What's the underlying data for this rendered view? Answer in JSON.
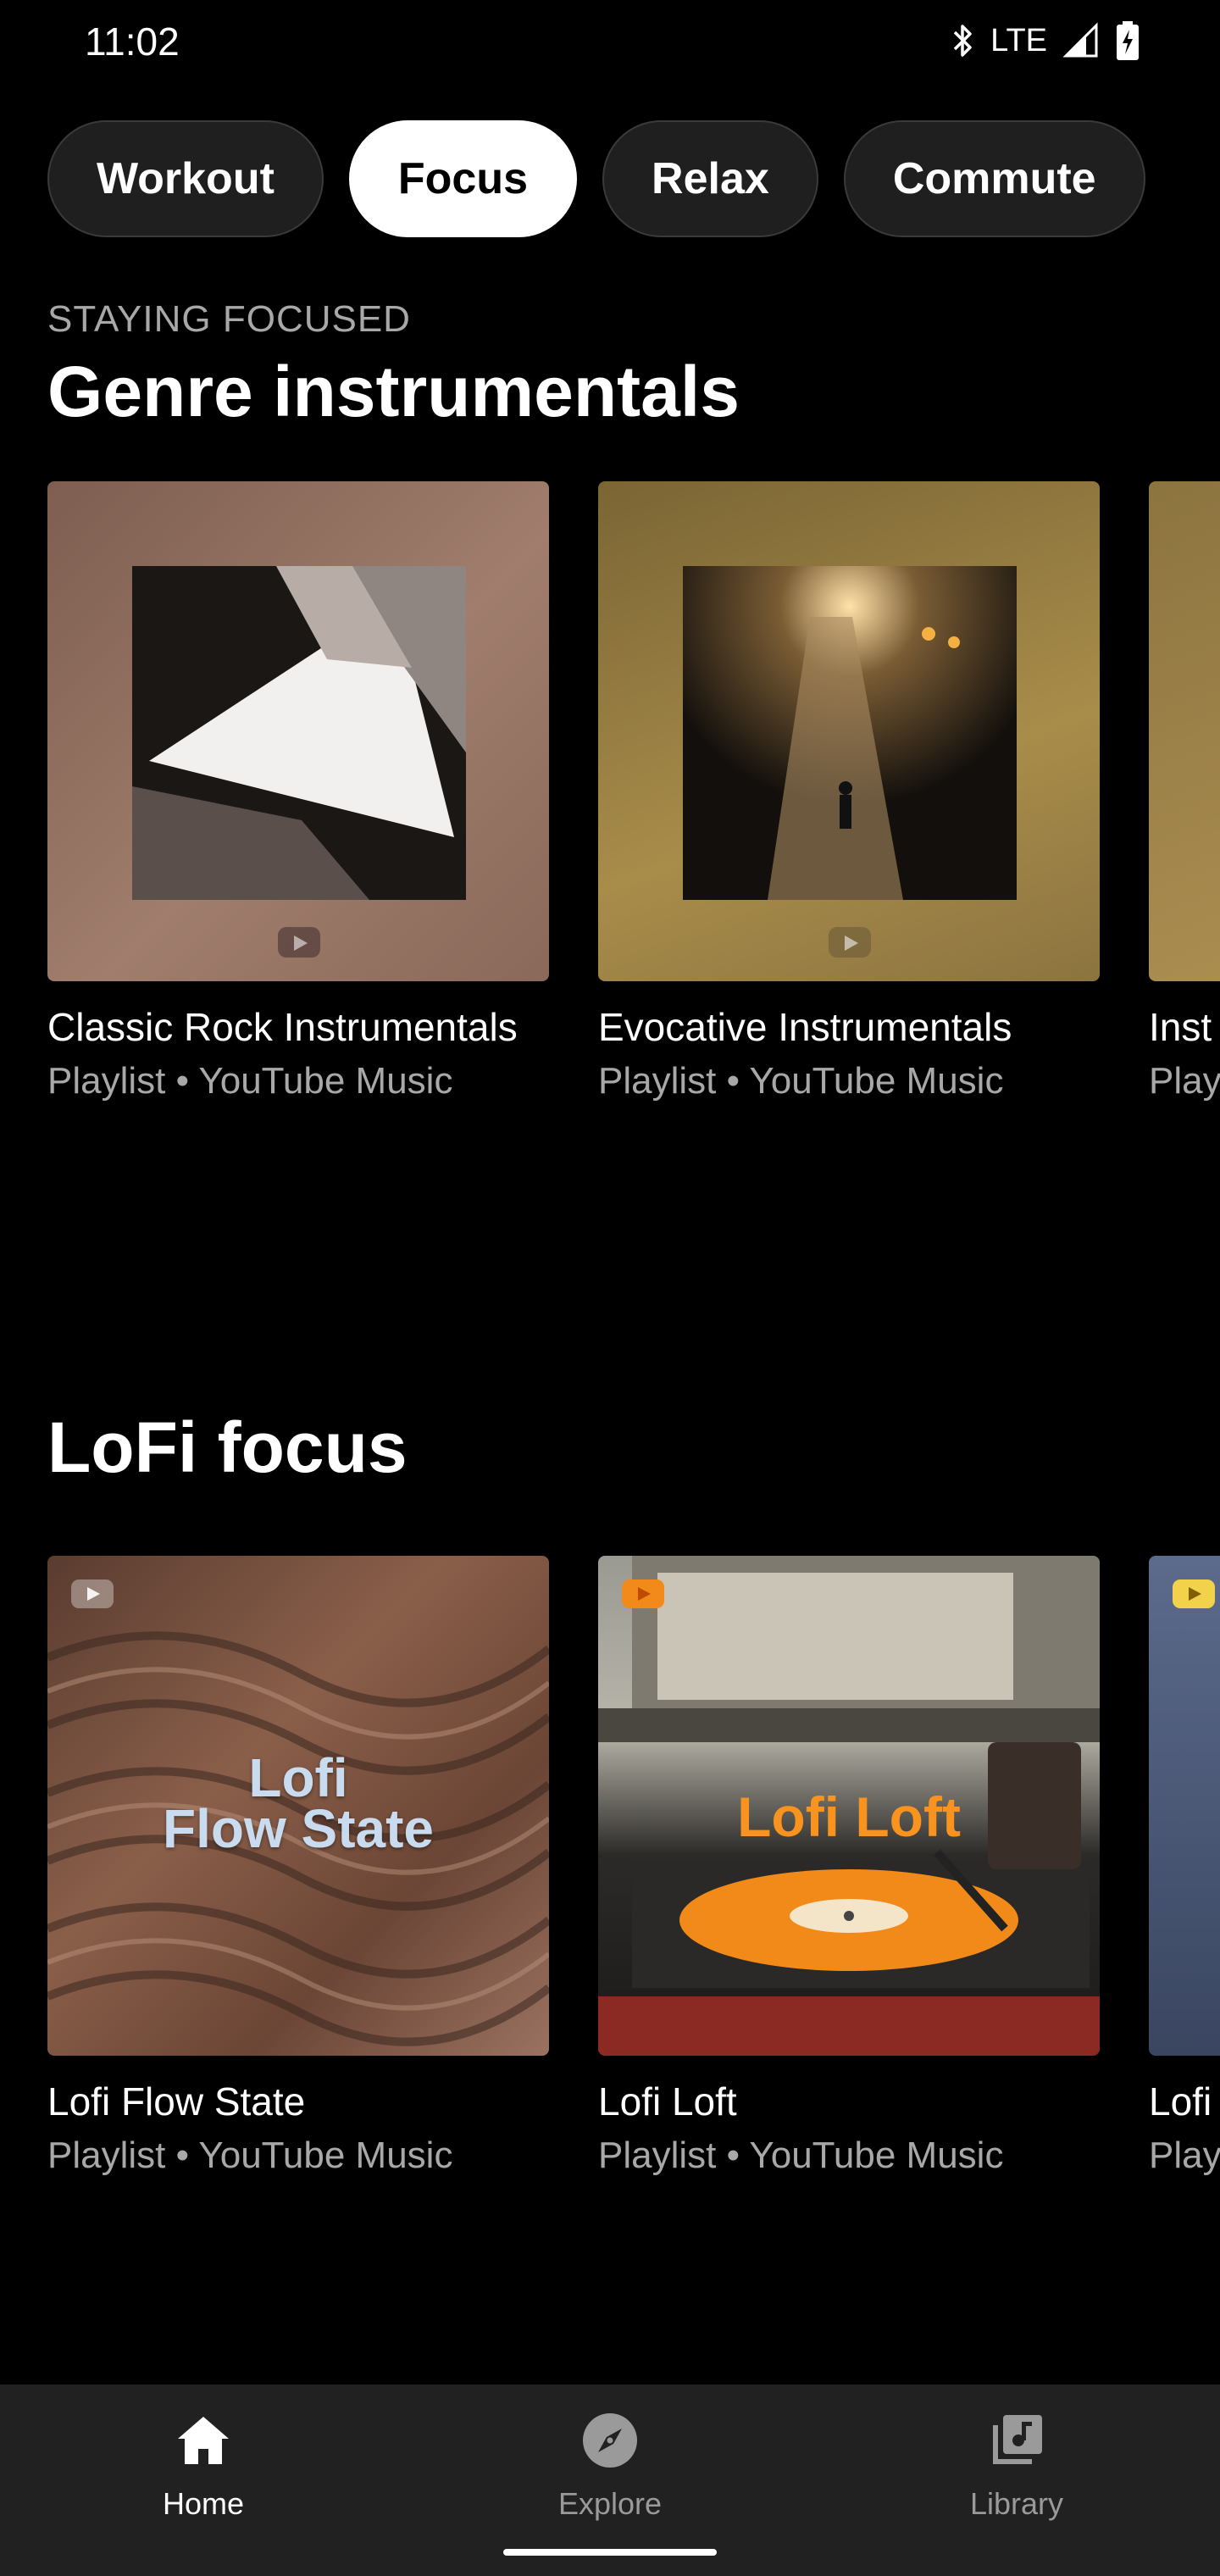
{
  "status_bar": {
    "time": "11:02",
    "network": "LTE"
  },
  "chips": [
    {
      "label": "Workout",
      "selected": false
    },
    {
      "label": "Focus",
      "selected": true
    },
    {
      "label": "Relax",
      "selected": false
    },
    {
      "label": "Commute",
      "selected": false
    }
  ],
  "sections": [
    {
      "kicker": "STAYING FOCUSED",
      "title": "Genre instrumentals",
      "cards": [
        {
          "title": "Classic Rock Instrumentals",
          "subtitle": "Playlist • YouTube Music"
        },
        {
          "title": "Evocative Instrumentals",
          "subtitle": "Playlist • YouTube Music"
        },
        {
          "title": "Inst",
          "subtitle": "Play"
        }
      ]
    },
    {
      "title": "LoFi focus",
      "cards": [
        {
          "title": "Lofi Flow State",
          "subtitle": "Playlist • YouTube Music",
          "art_text_line1": "Lofi",
          "art_text_line2": "Flow State"
        },
        {
          "title": "Lofi Loft",
          "subtitle": "Playlist • YouTube Music",
          "art_text": "Lofi Loft"
        },
        {
          "title": "Lofi",
          "subtitle": "Play"
        }
      ]
    }
  ],
  "bottom_nav": [
    {
      "label": "Home",
      "icon": "home-icon",
      "active": true
    },
    {
      "label": "Explore",
      "icon": "explore-icon",
      "active": false
    },
    {
      "label": "Library",
      "icon": "library-icon",
      "active": false
    }
  ],
  "colors": {
    "background": "#000000",
    "nav_background": "#212121",
    "lofi_loft_accent": "#f7931e"
  }
}
